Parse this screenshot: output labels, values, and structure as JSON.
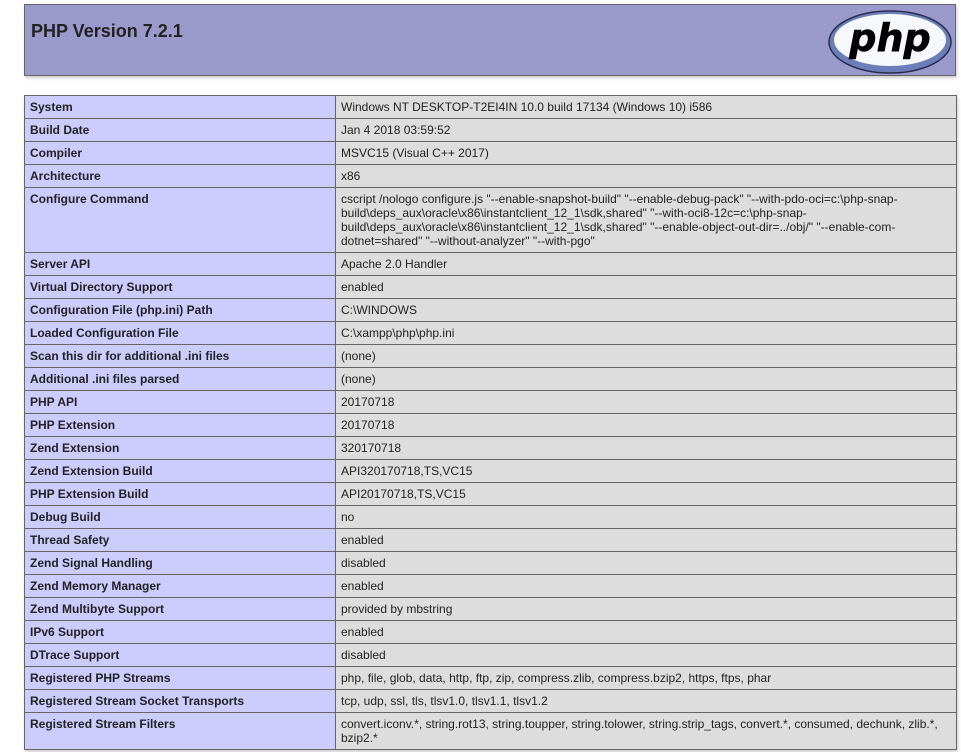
{
  "header": {
    "title": "PHP Version 7.2.1",
    "logo_text": "php",
    "colors": {
      "header_bg": "#9999cc",
      "label_bg": "#ccccff",
      "value_bg": "#dddddd",
      "border": "#666666",
      "logo_fill": "#6c7eb7",
      "logo_stroke": "#2b2b50"
    }
  },
  "rows": [
    {
      "label": "System",
      "value": "Windows NT DESKTOP-T2EI4IN 10.0 build 17134 (Windows 10) i586"
    },
    {
      "label": "Build Date",
      "value": "Jan 4 2018 03:59:52"
    },
    {
      "label": "Compiler",
      "value": "MSVC15 (Visual C++ 2017)"
    },
    {
      "label": "Architecture",
      "value": "x86"
    },
    {
      "label": "Configure Command",
      "value": "cscript /nologo configure.js \"--enable-snapshot-build\" \"--enable-debug-pack\" \"--with-pdo-oci=c:\\php-snap-build\\deps_aux\\oracle\\x86\\instantclient_12_1\\sdk,shared\" \"--with-oci8-12c=c:\\php-snap-build\\deps_aux\\oracle\\x86\\instantclient_12_1\\sdk,shared\" \"--enable-object-out-dir=../obj/\" \"--enable-com-dotnet=shared\" \"--without-analyzer\" \"--with-pgo\""
    },
    {
      "label": "Server API",
      "value": "Apache 2.0 Handler"
    },
    {
      "label": "Virtual Directory Support",
      "value": "enabled"
    },
    {
      "label": "Configuration File (php.ini) Path",
      "value": "C:\\WINDOWS"
    },
    {
      "label": "Loaded Configuration File",
      "value": "C:\\xampp\\php\\php.ini"
    },
    {
      "label": "Scan this dir for additional .ini files",
      "value": "(none)"
    },
    {
      "label": "Additional .ini files parsed",
      "value": "(none)"
    },
    {
      "label": "PHP API",
      "value": "20170718"
    },
    {
      "label": "PHP Extension",
      "value": "20170718"
    },
    {
      "label": "Zend Extension",
      "value": "320170718"
    },
    {
      "label": "Zend Extension Build",
      "value": "API320170718,TS,VC15"
    },
    {
      "label": "PHP Extension Build",
      "value": "API20170718,TS,VC15"
    },
    {
      "label": "Debug Build",
      "value": "no"
    },
    {
      "label": "Thread Safety",
      "value": "enabled"
    },
    {
      "label": "Zend Signal Handling",
      "value": "disabled"
    },
    {
      "label": "Zend Memory Manager",
      "value": "enabled"
    },
    {
      "label": "Zend Multibyte Support",
      "value": "provided by mbstring"
    },
    {
      "label": "IPv6 Support",
      "value": "enabled"
    },
    {
      "label": "DTrace Support",
      "value": "disabled"
    },
    {
      "label": "Registered PHP Streams",
      "value": "php, file, glob, data, http, ftp, zip, compress.zlib, compress.bzip2, https, ftps, phar"
    },
    {
      "label": "Registered Stream Socket Transports",
      "value": "tcp, udp, ssl, tls, tlsv1.0, tlsv1.1, tlsv1.2"
    },
    {
      "label": "Registered Stream Filters",
      "value": "convert.iconv.*, string.rot13, string.toupper, string.tolower, string.strip_tags, convert.*, consumed, dechunk, zlib.*, bzip2.*"
    }
  ]
}
